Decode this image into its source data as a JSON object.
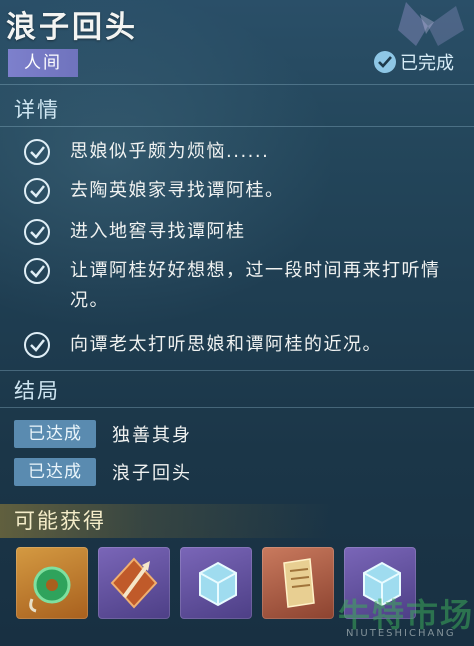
{
  "quest": {
    "title": "浪子回头",
    "world_tag": "人间",
    "status": "已完成"
  },
  "details": {
    "header": "详情",
    "steps": [
      "思娘似乎颇为烦恼......",
      "去陶英娘家寻找谭阿桂。",
      "进入地窖寻找谭阿桂",
      "让谭阿桂好好想想，过一段时间再来打听情况。",
      "向谭老太打听思娘和谭阿桂的近况。"
    ]
  },
  "endings": {
    "header": "结局",
    "items": [
      {
        "badge": "已达成",
        "name": "独善其身"
      },
      {
        "badge": "已达成",
        "name": "浪子回头"
      }
    ]
  },
  "rewards": {
    "header": "可能获得",
    "items": [
      {
        "icon": "jade-pendant-icon",
        "rarity_color": "#c07a2a"
      },
      {
        "icon": "sword-emblem-icon",
        "rarity_color": "#6a58a6"
      },
      {
        "icon": "ice-cube-icon",
        "rarity_color": "#6a58a6"
      },
      {
        "icon": "paper-scroll-icon",
        "rarity_color": "#b0604a"
      },
      {
        "icon": "ice-cube-icon",
        "rarity_color": "#6a58a6"
      }
    ]
  },
  "watermark": {
    "text": "牛特市场",
    "sub": "NIUTESHICHANG"
  },
  "colors": {
    "accent": "#8ec7e6",
    "badge": "#5a8bb0",
    "world_tag": "#7d80cc"
  }
}
